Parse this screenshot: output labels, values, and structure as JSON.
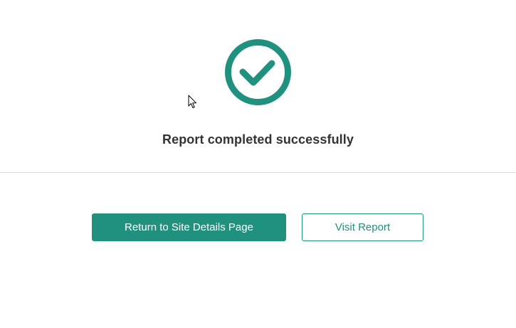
{
  "status": {
    "icon": "check-circle-icon",
    "message": "Report completed successfully"
  },
  "actions": {
    "primary_label": "Return to Site Details Page",
    "secondary_label": "Visit Report"
  },
  "colors": {
    "accent": "#21917f",
    "text": "#333333",
    "divider": "#dddddd"
  }
}
